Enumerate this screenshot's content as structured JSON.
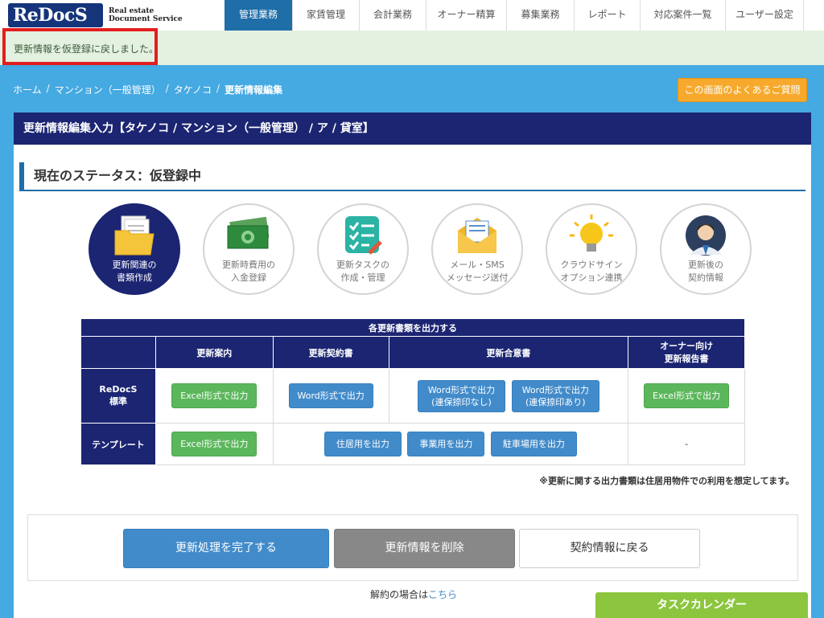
{
  "header": {
    "logo_text": "ReDocS",
    "logo_subtitle_1": "Real estate",
    "logo_subtitle_2": "Document Service",
    "nav": [
      {
        "label": "管理業務",
        "active": true
      },
      {
        "label": "家賃管理"
      },
      {
        "label": "会計業務"
      },
      {
        "label": "オーナー精算"
      },
      {
        "label": "募集業務"
      },
      {
        "label": "レポート"
      },
      {
        "label": "対応案件一覧"
      },
      {
        "label": "ユーザー設定"
      }
    ]
  },
  "flash": {
    "message": "更新情報を仮登録に戻しました。"
  },
  "breadcrumb": {
    "items": [
      "ホーム",
      "マンション（一般管理）",
      "タケノコ"
    ],
    "current": "更新情報編集"
  },
  "faq_button": "この画面のよくあるご質問",
  "panel": {
    "title": "更新情報編集入力【タケノコ / マンション（一般管理） / ア / 貸室】",
    "status": "現在のステータス：仮登録中"
  },
  "steps": [
    {
      "icon": "folder-documents-icon",
      "line1": "更新関連の",
      "line2": "書類作成",
      "active": true
    },
    {
      "icon": "money-icon",
      "line1": "更新時費用の",
      "line2": "入金登録"
    },
    {
      "icon": "task-checklist-icon",
      "line1": "更新タスクの",
      "line2": "作成・管理"
    },
    {
      "icon": "mail-icon",
      "line1": "メール・SMS",
      "line2": "メッセージ送付"
    },
    {
      "icon": "lightbulb-icon",
      "line1": "クラウドサイン",
      "line2": "オプション連携"
    },
    {
      "icon": "person-icon",
      "line1": "更新後の",
      "line2": "契約情報"
    }
  ],
  "output_table": {
    "title": "各更新書類を出力する",
    "columns": [
      "更新案内",
      "更新契約書",
      "更新合意書",
      "オーナー向け",
      "更新報告書"
    ],
    "rows": {
      "standard": {
        "label_1": "ReDocS",
        "label_2": "標準",
        "guide_btn": "Excel形式で出力",
        "contract_btn": "Word形式で出力",
        "agreement_btn_1a": "Word形式で出力",
        "agreement_btn_1b": "(連保捺印なし)",
        "agreement_btn_2a": "Word形式で出力",
        "agreement_btn_2b": "(連保捺印あり)",
        "owner_btn": "Excel形式で出力"
      },
      "template": {
        "label": "テンプレート",
        "guide_btn": "Excel形式で出力",
        "residential_btn": "住居用を出力",
        "business_btn": "事業用を出力",
        "parking_btn": "駐車場用を出力",
        "owner_value": "-"
      }
    },
    "note": "※更新に関する出力書類は住居用物件での利用を想定してます。"
  },
  "actions": {
    "complete": "更新処理を完了する",
    "delete": "更新情報を削除",
    "back": "契約情報に戻る"
  },
  "cancel": {
    "text": "解約の場合は",
    "link": "こちら"
  },
  "task_calendar": "タスクカレンダー",
  "colors": {
    "nav_active": "#1f6ea8",
    "panel_header": "#1b2572",
    "background": "#45a9e2",
    "faq": "#f6a92d",
    "highlight_box": "#e31e1e",
    "task_calendar": "#8cc63f"
  }
}
